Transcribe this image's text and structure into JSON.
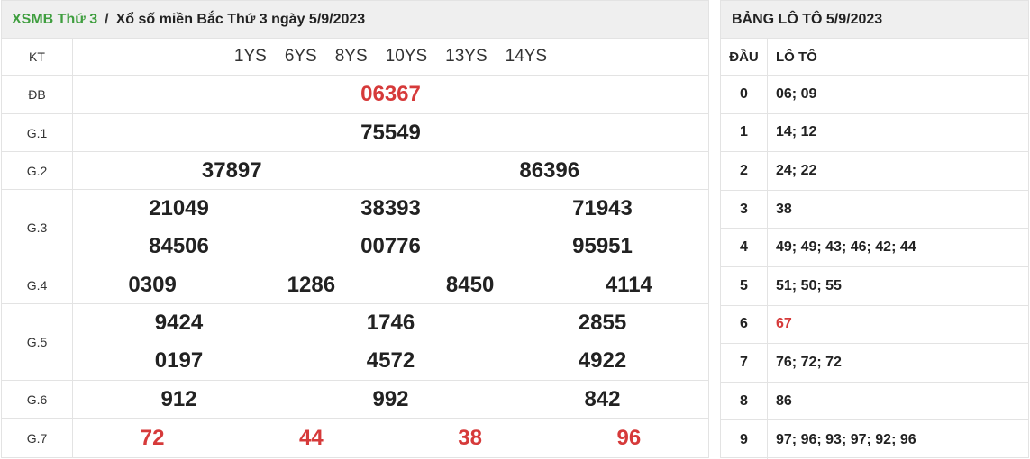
{
  "breadcrumb": {
    "link": "XSMB Thứ 3",
    "separator": "/",
    "current": "Xổ số miền Bắc Thứ 3 ngày 5/9/2023"
  },
  "results": {
    "kt": {
      "label": "KT",
      "codes": [
        "1YS",
        "6YS",
        "8YS",
        "10YS",
        "13YS",
        "14YS"
      ]
    },
    "db": {
      "label": "ĐB",
      "values": [
        "06367"
      ]
    },
    "g1": {
      "label": "G.1",
      "values": [
        "75549"
      ]
    },
    "g2": {
      "label": "G.2",
      "values": [
        "37897",
        "86396"
      ]
    },
    "g3": {
      "label": "G.3",
      "values": [
        "21049",
        "38393",
        "71943",
        "84506",
        "00776",
        "95951"
      ]
    },
    "g4": {
      "label": "G.4",
      "values": [
        "0309",
        "1286",
        "8450",
        "4114"
      ]
    },
    "g5": {
      "label": "G.5",
      "values": [
        "9424",
        "1746",
        "2855",
        "0197",
        "4572",
        "4922"
      ]
    },
    "g6": {
      "label": "G.6",
      "values": [
        "912",
        "992",
        "842"
      ]
    },
    "g7": {
      "label": "G.7",
      "values": [
        "72",
        "44",
        "38",
        "96"
      ]
    }
  },
  "loto": {
    "title": "BẢNG LÔ TÔ 5/9/2023",
    "head_col": "ĐẦU",
    "loto_col": "LÔ TÔ",
    "rows": [
      {
        "dau": "0",
        "values": "06; 09"
      },
      {
        "dau": "1",
        "values": "14; 12"
      },
      {
        "dau": "2",
        "values": "24; 22"
      },
      {
        "dau": "3",
        "values": "38"
      },
      {
        "dau": "4",
        "values": "49; 49; 43; 46; 42; 44"
      },
      {
        "dau": "5",
        "values": "51; 50; 55"
      },
      {
        "dau": "6",
        "values": "67"
      },
      {
        "dau": "7",
        "values": "76; 72; 72"
      },
      {
        "dau": "8",
        "values": "86"
      },
      {
        "dau": "9",
        "values": "97; 96; 93; 97; 92; 96"
      }
    ]
  },
  "colors": {
    "accent_green": "#3f9e3f",
    "highlight_red": "#d63a3a",
    "header_bg": "#efefef"
  }
}
